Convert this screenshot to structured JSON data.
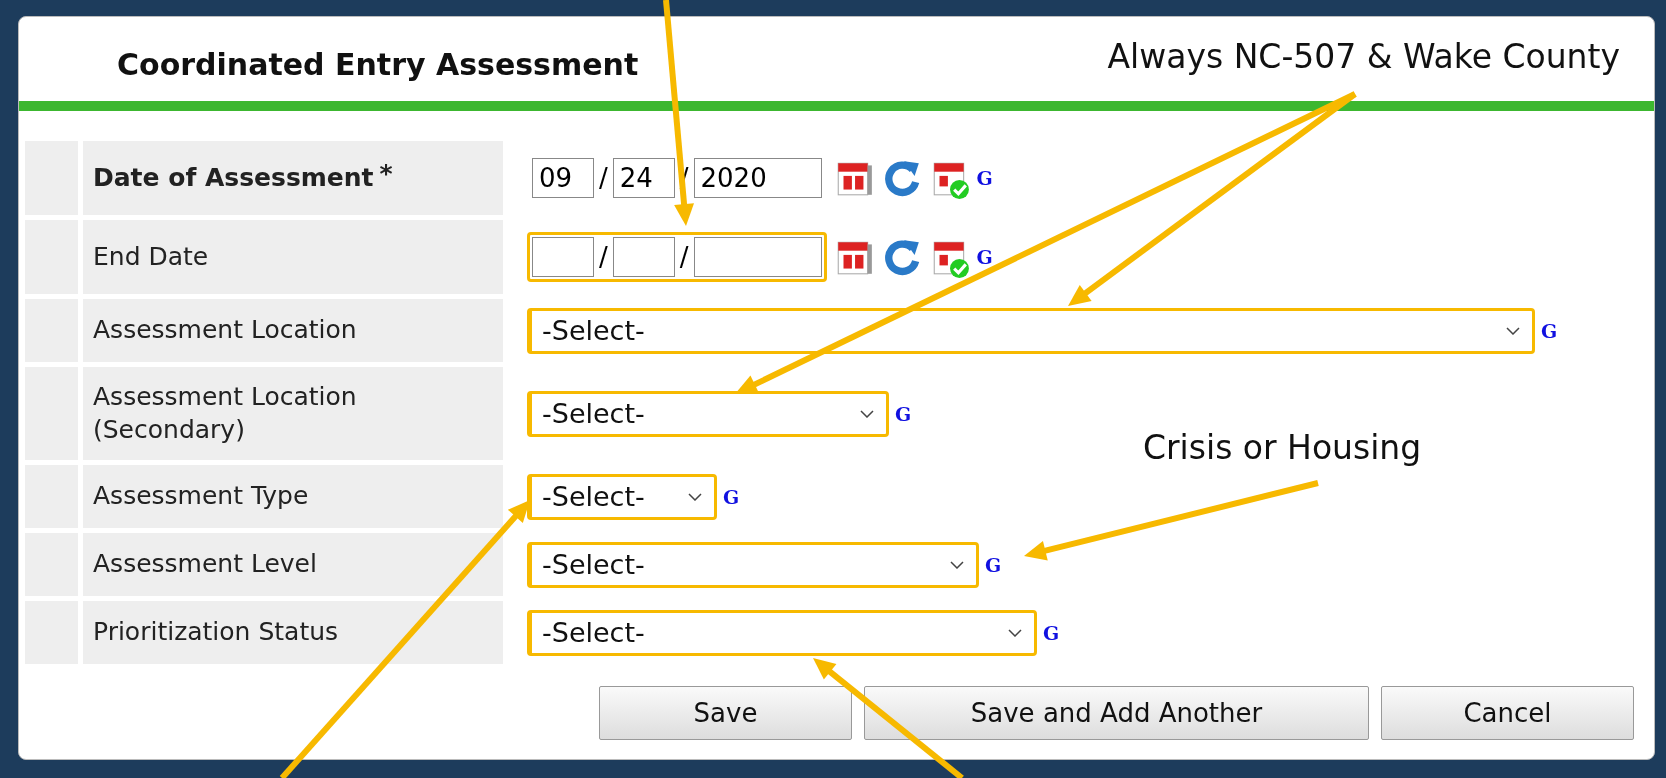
{
  "form": {
    "title": "Coordinated Entry Assessment",
    "rows": [
      {
        "label": "Date of Assessment",
        "required": true,
        "required_mark": "*",
        "kind": "date",
        "month": "09",
        "day": "24",
        "year": "2020",
        "separator": "/",
        "highlighted": false,
        "help": "G"
      },
      {
        "label": "End Date",
        "required": false,
        "kind": "date",
        "separator": "/",
        "highlighted": true,
        "help": "G"
      },
      {
        "label": "Assessment Location",
        "required": false,
        "kind": "select",
        "value": "-Select-",
        "highlighted": true,
        "help": "G"
      },
      {
        "label": "Assessment Location (Secondary)",
        "required": false,
        "kind": "select",
        "value": "-Select-",
        "highlighted": true,
        "help": "G"
      },
      {
        "label": "Assessment Type",
        "required": false,
        "kind": "select",
        "value": "-Select-",
        "highlighted": true,
        "help": "G"
      },
      {
        "label": "Assessment Level",
        "required": false,
        "kind": "select",
        "value": "-Select-",
        "highlighted": true,
        "help": "G"
      },
      {
        "label": "Prioritization Status",
        "required": false,
        "kind": "select",
        "value": "-Select-",
        "highlighted": true,
        "help": "G"
      }
    ],
    "buttons": [
      "Save",
      "Save and Add Another",
      "Cancel"
    ]
  },
  "annotations": [
    {
      "text": "Always NC-507 & Wake County"
    },
    {
      "text": "Crisis or Housing"
    }
  ]
}
